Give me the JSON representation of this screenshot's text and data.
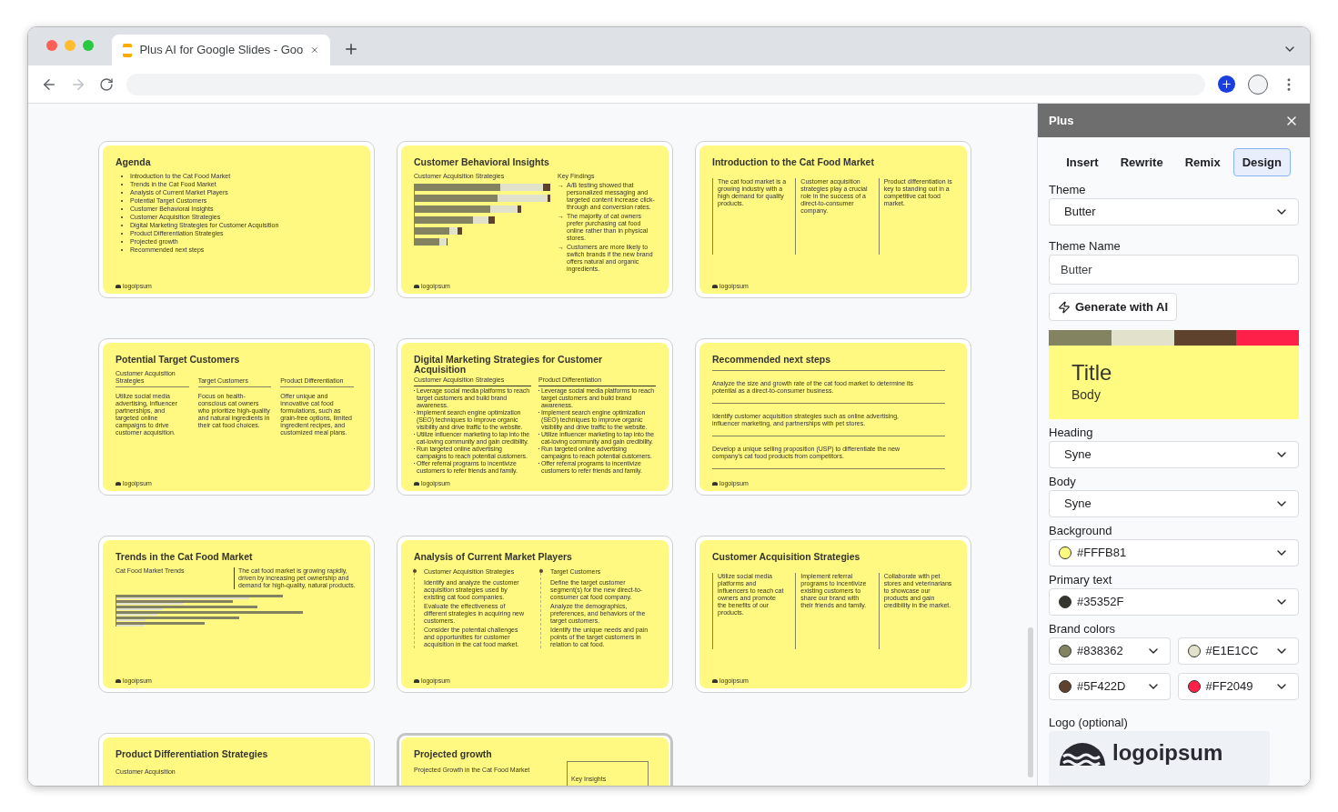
{
  "browser": {
    "tab_title": "Plus AI for Google Slides - Goo"
  },
  "slides": [
    {
      "kind": "list",
      "selected": false,
      "title": "Agenda",
      "items": [
        "Introduction to the Cat Food Market",
        "Trends in the Cat Food Market",
        "Analysis of Current Market Players",
        "Potential Target Customers",
        "Customer Behavioral Insights",
        "Customer Acquisition Strategies",
        "Digital Marketing Strategies for Customer Acquisition",
        "Product Differentiation Strategies",
        "Projected growth",
        "Recommended next steps"
      ],
      "footer": "logoipsum"
    },
    {
      "kind": "chart-findings",
      "selected": false,
      "title": "Customer Behavioral Insights",
      "chart_label": "Customer Acquisition Strategies",
      "findings_title": "Key Findings",
      "finding_marker": "→",
      "findings": [
        "A/B testing showed that personalized messaging and targeted content increase click-through and conversion rates.",
        "The majority of cat owners prefer purchasing cat food online rather than in physical stores.",
        "Customers are more likely to switch brands if the new brand offers natural and organic ingredients."
      ],
      "footer": "logoipsum"
    },
    {
      "kind": "columns",
      "selected": false,
      "title": "Introduction to the Cat Food Market",
      "columns": [
        "The cat food market is a growing industry with a high demand for quality products.",
        "Customer acquisition strategies play a crucial role in the success of a direct-to-consumer company.",
        "Product differentiation is key to standing out in a competitive cat food market."
      ],
      "footer": "logoipsum"
    },
    {
      "kind": "headed-columns",
      "selected": false,
      "title": "Potential Target Customers",
      "columns": [
        {
          "heading": "Customer Acquisition Strategies",
          "text": "Utilize social media advertising, influencer partnerships, and targeted online campaigns to drive customer acquisition."
        },
        {
          "heading": "Target Customers",
          "text": "Focus on health-conscious cat owners who prioritize high-quality and natural ingredients in their cat food choices."
        },
        {
          "heading": "Product Differentiation",
          "text": "Offer unique and innovative cat food formulations, such as grain-free options, limited ingredient recipes, and customized meal plans."
        }
      ],
      "footer": "logoipsum"
    },
    {
      "kind": "two-lists",
      "selected": false,
      "title": "Digital Marketing Strategies for Customer Acquisition",
      "columns": [
        {
          "heading": "Customer Acquisition Strategies",
          "items": [
            "Leverage social media platforms to reach target customers and build brand awareness.",
            "Implement search engine optimization (SEO) techniques to improve organic visibility and drive traffic to the website.",
            "Utilize influencer marketing to tap into the cat-loving community and gain credibility.",
            "Run targeted online advertising campaigns to reach potential customers.",
            "Offer referral programs to incentivize customers to refer friends and family."
          ]
        },
        {
          "heading": "Product Differentiation",
          "items": [
            "Leverage social media platforms to reach target customers and build brand awareness.",
            "Implement search engine optimization (SEO) techniques to improve organic visibility and drive traffic to the website.",
            "Utilize influencer marketing to tap into the cat-loving community and gain credibility.",
            "Run targeted online advertising campaigns to reach potential customers.",
            "Offer referral programs to incentivize customers to refer friends and family."
          ]
        }
      ],
      "footer": "logoipsum"
    },
    {
      "kind": "rows",
      "selected": false,
      "title": "Recommended next steps",
      "rows": [
        "Analyze the size and growth rate of the cat food market to determine its potential as a direct-to-consumer business.",
        "Identify customer acquisition strategies such as online advertising, influencer marketing, and partnerships with pet stores.",
        "Develop a unique selling proposition (USP) to differentiate the new company's cat food products from competitors."
      ],
      "footer": "logoipsum"
    },
    {
      "kind": "trends",
      "selected": false,
      "title": "Trends in the Cat Food Market",
      "chart_label": "Cat Food Market Trends",
      "note": "The cat food market is growing rapidly, driven by increasing pet ownership and demand for high-quality, natural products.",
      "footer": "logoipsum"
    },
    {
      "kind": "players",
      "selected": false,
      "title": "Analysis of Current Market Players",
      "columns": [
        {
          "heading": "Customer Acquisition Strategies",
          "items": [
            "Identify and analyze the customer acquisition strategies used by existing cat food companies.",
            "Evaluate the effectiveness of different strategies in acquiring new customers.",
            "Consider the potential challenges and opportunities for customer acquisition in the cat food market."
          ]
        },
        {
          "heading": "Target Customers",
          "items": [
            "Define the target customer segment(s) for the new direct-to-consumer cat food company.",
            "Analyze the demographics, preferences, and behaviors of the target customers.",
            "Identify the unique needs and pain points of the target customers in relation to cat food."
          ]
        }
      ],
      "footer": "logoipsum"
    },
    {
      "kind": "columns",
      "selected": false,
      "title": "Customer Acquisition Strategies",
      "columns": [
        "Utilize social media platforms and influencers to reach cat owners and promote the benefits of our products.",
        "Implement referral programs to incentivize existing customers to share our brand with their friends and family.",
        "Collaborate with pet stores and veterinarians to showcase our products and gain credibility in the market."
      ],
      "footer": "logoipsum"
    },
    {
      "kind": "partial",
      "selected": false,
      "title": "Product Differentiation Strategies",
      "subtitle": "Customer Acquisition"
    },
    {
      "kind": "growth",
      "selected": true,
      "title": "Projected growth",
      "chart_label": "Projected Growth in the Cat Food Market",
      "box_title": "Key Insights"
    }
  ],
  "panel": {
    "title": "Plus",
    "tabs": [
      {
        "label": "Insert",
        "selected": false
      },
      {
        "label": "Rewrite",
        "selected": false
      },
      {
        "label": "Remix",
        "selected": false
      },
      {
        "label": "Design",
        "selected": true
      }
    ],
    "theme": {
      "label": "Theme",
      "value": "Butter"
    },
    "theme_name": {
      "label": "Theme Name",
      "value": "Butter"
    },
    "generate_button": "Generate with AI",
    "palette": [
      {
        "color": "#838362"
      },
      {
        "color": "#e1e1cc"
      },
      {
        "color": "#5f422d"
      },
      {
        "color": "#ff2049"
      }
    ],
    "preview": {
      "title": "Title",
      "body": "Body"
    },
    "heading": {
      "label": "Heading",
      "value": "Syne"
    },
    "body": {
      "label": "Body",
      "value": "Syne"
    },
    "background": {
      "label": "Background",
      "value": "#FFFB81",
      "color": "#fffb81"
    },
    "primary_text": {
      "label": "Primary text",
      "value": "#35352F",
      "color": "#35352f"
    },
    "brand_colors": {
      "label": "Brand colors",
      "items": [
        {
          "value": "#838362",
          "color": "#838362"
        },
        {
          "value": "#E1E1CC",
          "color": "#e1e1cc"
        },
        {
          "value": "#5F422D",
          "color": "#5f422d"
        },
        {
          "value": "#FF2049",
          "color": "#ff2049"
        }
      ]
    },
    "logo": {
      "label": "Logo (optional)",
      "text": "logoipsum"
    }
  }
}
